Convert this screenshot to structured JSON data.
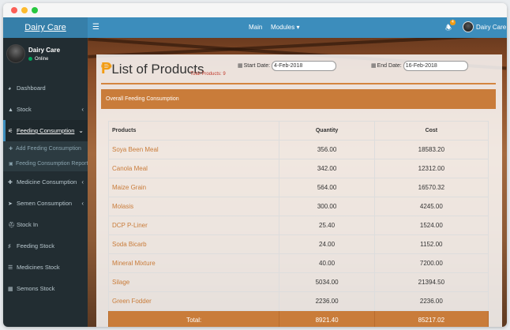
{
  "app": {
    "brand": "Dairy Care"
  },
  "topnav": {
    "main": "Main",
    "modules": "Modules",
    "notifications": "4",
    "user": "Dairy Care"
  },
  "profile": {
    "name": "Dairy Care",
    "status": "Online"
  },
  "sidebar": {
    "items": [
      {
        "label": "Dashboard",
        "icon": "dashboard-icon"
      },
      {
        "label": "Stock",
        "icon": "stock-icon"
      },
      {
        "label": "Feeding Consumption",
        "icon": "feeding-icon"
      },
      {
        "label": "Medicine Consumption",
        "icon": "medicine-icon"
      },
      {
        "label": "Semen Consumption",
        "icon": "semen-icon"
      },
      {
        "label": "Stock In",
        "icon": "cart-icon"
      },
      {
        "label": "Feeding Stock",
        "icon": "cutlery-icon"
      },
      {
        "label": "Medicines Stock",
        "icon": "list-icon"
      },
      {
        "label": "Semons Stock",
        "icon": "grid-icon"
      }
    ],
    "submenu": [
      {
        "label": "Add Feeding Consumption"
      },
      {
        "label": "Feeding Consumption Report"
      }
    ]
  },
  "page": {
    "title": "List of Products",
    "total_products_label": "Total Products: 9",
    "start_date_label": "Start Date:",
    "start_date": "4-Feb-2018",
    "end_date_label": "End Date:",
    "end_date": "16-Feb-2018",
    "section": "Overall Feeding Consumption"
  },
  "table": {
    "headers": [
      "Products",
      "Quantity",
      "Cost"
    ],
    "rows": [
      [
        "Soya Been Meal",
        "356.00",
        "18583.20"
      ],
      [
        "Canola Meal",
        "342.00",
        "12312.00"
      ],
      [
        "Maize Grain",
        "564.00",
        "16570.32"
      ],
      [
        "Molasis",
        "300.00",
        "4245.00"
      ],
      [
        "DCP P-Liner",
        "25.40",
        "1524.00"
      ],
      [
        "Soda Bicarb",
        "24.00",
        "1152.00"
      ],
      [
        "Mineral Mixture",
        "40.00",
        "7200.00"
      ],
      [
        "Silage",
        "5034.00",
        "21394.50"
      ],
      [
        "Green Fodder",
        "2236.00",
        "2236.00"
      ]
    ],
    "total": [
      "Total:",
      "8921.40",
      "85217.02"
    ]
  }
}
